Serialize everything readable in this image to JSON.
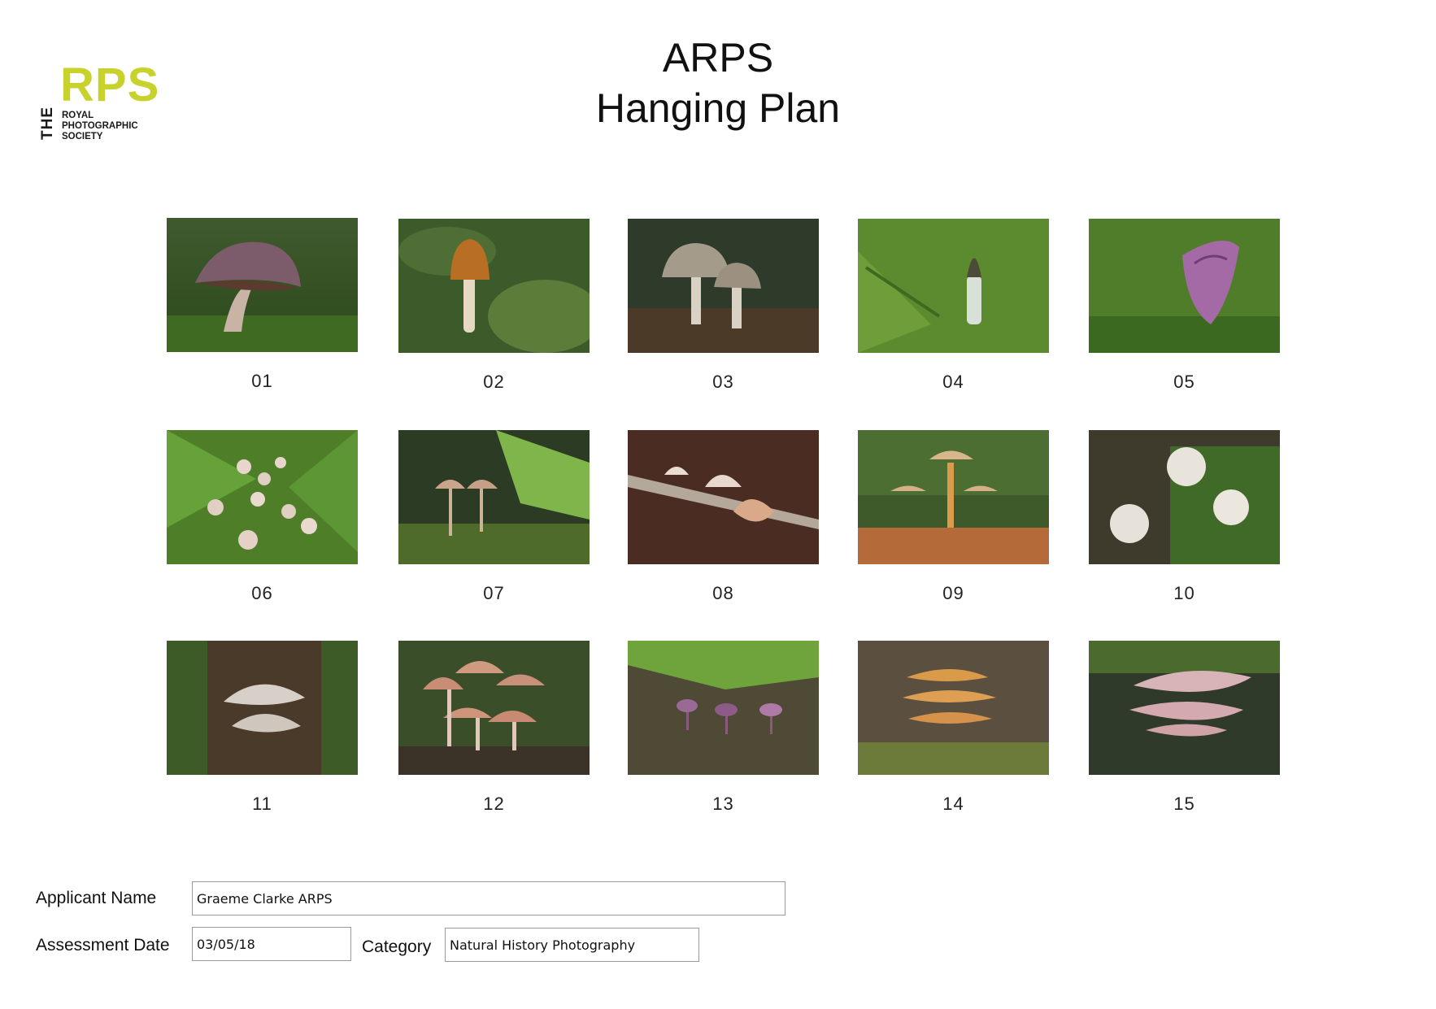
{
  "logo": {
    "the": "THE",
    "rps": "RPS",
    "society_lines": [
      "ROYAL",
      "PHOTOGRAPHIC",
      "SOCIETY"
    ]
  },
  "title": {
    "line1": "ARPS",
    "line2": "Hanging Plan"
  },
  "images": [
    {
      "number": "01",
      "subject": "purple-cap-toadstool"
    },
    {
      "number": "02",
      "subject": "brown-cap-mushroom-in-moss"
    },
    {
      "number": "03",
      "subject": "two-scaly-cap-mushrooms"
    },
    {
      "number": "04",
      "subject": "stinkhorn-among-ferns"
    },
    {
      "number": "05",
      "subject": "purple-fungus-in-moss"
    },
    {
      "number": "06",
      "subject": "puffballs-among-ferns"
    },
    {
      "number": "07",
      "subject": "slender-mushrooms-with-ferns"
    },
    {
      "number": "08",
      "subject": "fungi-on-branch"
    },
    {
      "number": "09",
      "subject": "golden-mushrooms-on-mossy-log"
    },
    {
      "number": "10",
      "subject": "white-puffballs-on-moss"
    },
    {
      "number": "11",
      "subject": "pale-cluster-on-tree"
    },
    {
      "number": "12",
      "subject": "pink-mushroom-cluster"
    },
    {
      "number": "13",
      "subject": "amethyst-deceivers-under-fern"
    },
    {
      "number": "14",
      "subject": "orange-bracket-fungus"
    },
    {
      "number": "15",
      "subject": "oyster-fungus-on-bark"
    }
  ],
  "form": {
    "applicant_label": "Applicant Name",
    "applicant_value": "Graeme Clarke ARPS",
    "date_label": "Assessment Date",
    "date_value": "03/05/18",
    "category_label": "Category",
    "category_value": "Natural History Photography"
  }
}
